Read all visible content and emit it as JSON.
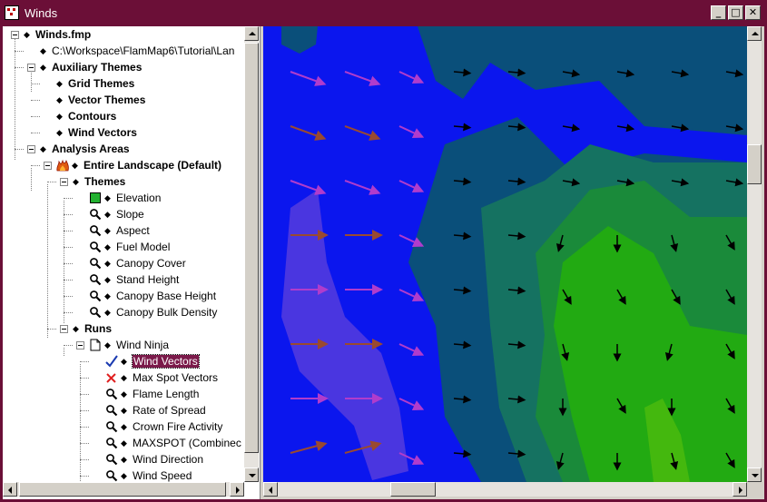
{
  "window": {
    "title": "Winds",
    "minimize_glyph": "_",
    "maximize_glyph": "□",
    "close_glyph": "✕"
  },
  "tree": [
    {
      "id": "winds-fmp",
      "label": "Winds.fmp",
      "bold": true,
      "icon": "diamond"
    },
    {
      "id": "workspace-path",
      "label": "C:\\Workspace\\FlamMap6\\Tutorial\\Lan",
      "bold": false,
      "icon": "diamond"
    },
    {
      "id": "auxiliary-themes",
      "label": "Auxiliary Themes",
      "bold": true,
      "icon": "diamond"
    },
    {
      "id": "grid-themes",
      "label": "Grid Themes",
      "bold": true,
      "icon": "diamond"
    },
    {
      "id": "vector-themes",
      "label": "Vector Themes",
      "bold": true,
      "icon": "diamond"
    },
    {
      "id": "contours",
      "label": "Contours",
      "bold": true,
      "icon": "diamond"
    },
    {
      "id": "wind-vectors-aux",
      "label": "Wind Vectors",
      "bold": true,
      "icon": "diamond"
    },
    {
      "id": "analysis-areas",
      "label": "Analysis Areas",
      "bold": true,
      "icon": "diamond"
    },
    {
      "id": "entire-landscape",
      "label": "Entire Landscape (Default)",
      "bold": true,
      "icon": "fire-icon"
    },
    {
      "id": "themes",
      "label": "Themes",
      "bold": true,
      "icon": "diamond"
    },
    {
      "id": "elevation",
      "label": "Elevation",
      "bold": false,
      "icon": "green-square-icon"
    },
    {
      "id": "slope",
      "label": "Slope",
      "bold": false,
      "icon": "magnifier-icon"
    },
    {
      "id": "aspect",
      "label": "Aspect",
      "bold": false,
      "icon": "magnifier-icon"
    },
    {
      "id": "fuel-model",
      "label": "Fuel Model",
      "bold": false,
      "icon": "magnifier-icon"
    },
    {
      "id": "canopy-cover",
      "label": "Canopy Cover",
      "bold": false,
      "icon": "magnifier-icon"
    },
    {
      "id": "stand-height",
      "label": "Stand Height",
      "bold": false,
      "icon": "magnifier-icon"
    },
    {
      "id": "canopy-base-height",
      "label": "Canopy Base Height",
      "bold": false,
      "icon": "magnifier-icon"
    },
    {
      "id": "canopy-bulk-density",
      "label": "Canopy Bulk Density",
      "bold": false,
      "icon": "magnifier-icon"
    },
    {
      "id": "runs",
      "label": "Runs",
      "bold": true,
      "icon": "diamond"
    },
    {
      "id": "wind-ninja",
      "label": "Wind Ninja",
      "bold": false,
      "icon": "document-icon"
    },
    {
      "id": "wind-vectors-run",
      "label": "Wind Vectors",
      "bold": false,
      "icon": "checkmark-icon",
      "selected": true
    },
    {
      "id": "max-spot-vectors",
      "label": "Max Spot Vectors",
      "bold": false,
      "icon": "red-x-icon"
    },
    {
      "id": "flame-length",
      "label": "Flame Length",
      "bold": false,
      "icon": "magnifier-icon"
    },
    {
      "id": "rate-of-spread",
      "label": "Rate of Spread",
      "bold": false,
      "icon": "magnifier-icon"
    },
    {
      "id": "crown-fire-activity",
      "label": "Crown Fire Activity",
      "bold": false,
      "icon": "magnifier-icon"
    },
    {
      "id": "maxspot-combined",
      "label": "MAXSPOT (Combinec",
      "bold": false,
      "icon": "magnifier-icon"
    },
    {
      "id": "wind-direction",
      "label": "Wind Direction",
      "bold": false,
      "icon": "magnifier-icon"
    },
    {
      "id": "wind-speed",
      "label": "Wind Speed",
      "bold": false,
      "icon": "magnifier-icon"
    }
  ],
  "colors": {
    "title_bar": "#6b0f37",
    "selection": "#7b1a4a",
    "map_blue": "#0b16ee",
    "map_dark_teal": "#0a4f7a",
    "map_teal": "#157261",
    "map_green_dark": "#1a8a3a",
    "map_green": "#22aa12",
    "map_green_light": "#44b80e",
    "vector_purple": "#b03ccc",
    "vector_brown": "#9a4a30",
    "vector_black": "#000000"
  }
}
